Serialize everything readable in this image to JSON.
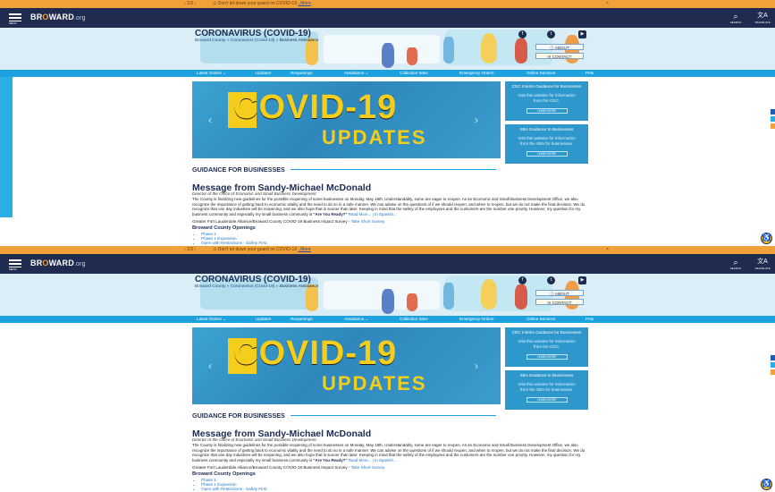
{
  "alert": {
    "pager": "‹ 1/3 ›",
    "icon": "⚠",
    "text": "Don't let down your guard on COVID-19",
    "more": "..More",
    "close": "×"
  },
  "header": {
    "menu_label": "MENU",
    "logo_left": "BR",
    "logo_accent": "O",
    "logo_right": "WARD",
    "logo_suffix": ".org",
    "search_label": "SEARCH",
    "translate_label": "TRANSLATE"
  },
  "hero": {
    "title": "CORONAVIRUS (COVID-19)",
    "breadcrumb": [
      "Broward County",
      "Coronavirus (Covid-19)",
      "Business Assistance"
    ],
    "about": "ⓘ ABOUT",
    "contact": "✉ CONTACT"
  },
  "nav": [
    "Latest Orders ⌄",
    "Updates",
    "Reopenings",
    "Assistance ⌄",
    "Collection Sites",
    "Emergency Orders",
    "Online Services",
    "Pets"
  ],
  "slider": {
    "word1": "COVID-19",
    "word2": "UPDATES"
  },
  "promos": [
    {
      "title": "CDC Interim Guidance for Businesses",
      "desc": "Visit this website for information from the CDC.",
      "button": "LEARN MORE"
    },
    {
      "title": "SBA Guidance to Businesses",
      "desc": "Visit this website for information from the SBA for businesses.",
      "button": "LEARN MORE"
    }
  ],
  "guidance": {
    "section": "GUIDANCE FOR BUSINESSES",
    "title": "Message from Sandy-Michael McDonald",
    "subtitle": "Director of the Office of Economic and Small Business Development",
    "body": "The County is finalizing new guidelines for the possible reopening of some businesses on Monday, May 18th. Understandably, some are eager to reopen. As an Economic and Small Business Development Office, we also recognize the importance of getting back to economic vitality and the need to do so in a safe manner. We can advise on the questions of if we should reopen, and when to reopen, but we do not make the final decision. We do recognize that one day industries will be reopening, and we also hope that is sooner than later. Keeping in mind that the safety of the employees and the customers are the number one priority. However, my question for my business community and especially my small business community is",
    "body_bold": "\"Are You Ready?\"",
    "body_links": "Read More... | In Spanish...",
    "survey": "Greater Fort Lauderdale Alliance/Broward County COVID-19 Business Impact Survey -",
    "survey_link": "Take Short Survey",
    "openings_title": "Broward County Openings",
    "openings": [
      "Phase 1",
      "Phase 1 Expansion",
      "Open with Restrictions - Safety First"
    ]
  },
  "accessibility_icon": "♿"
}
